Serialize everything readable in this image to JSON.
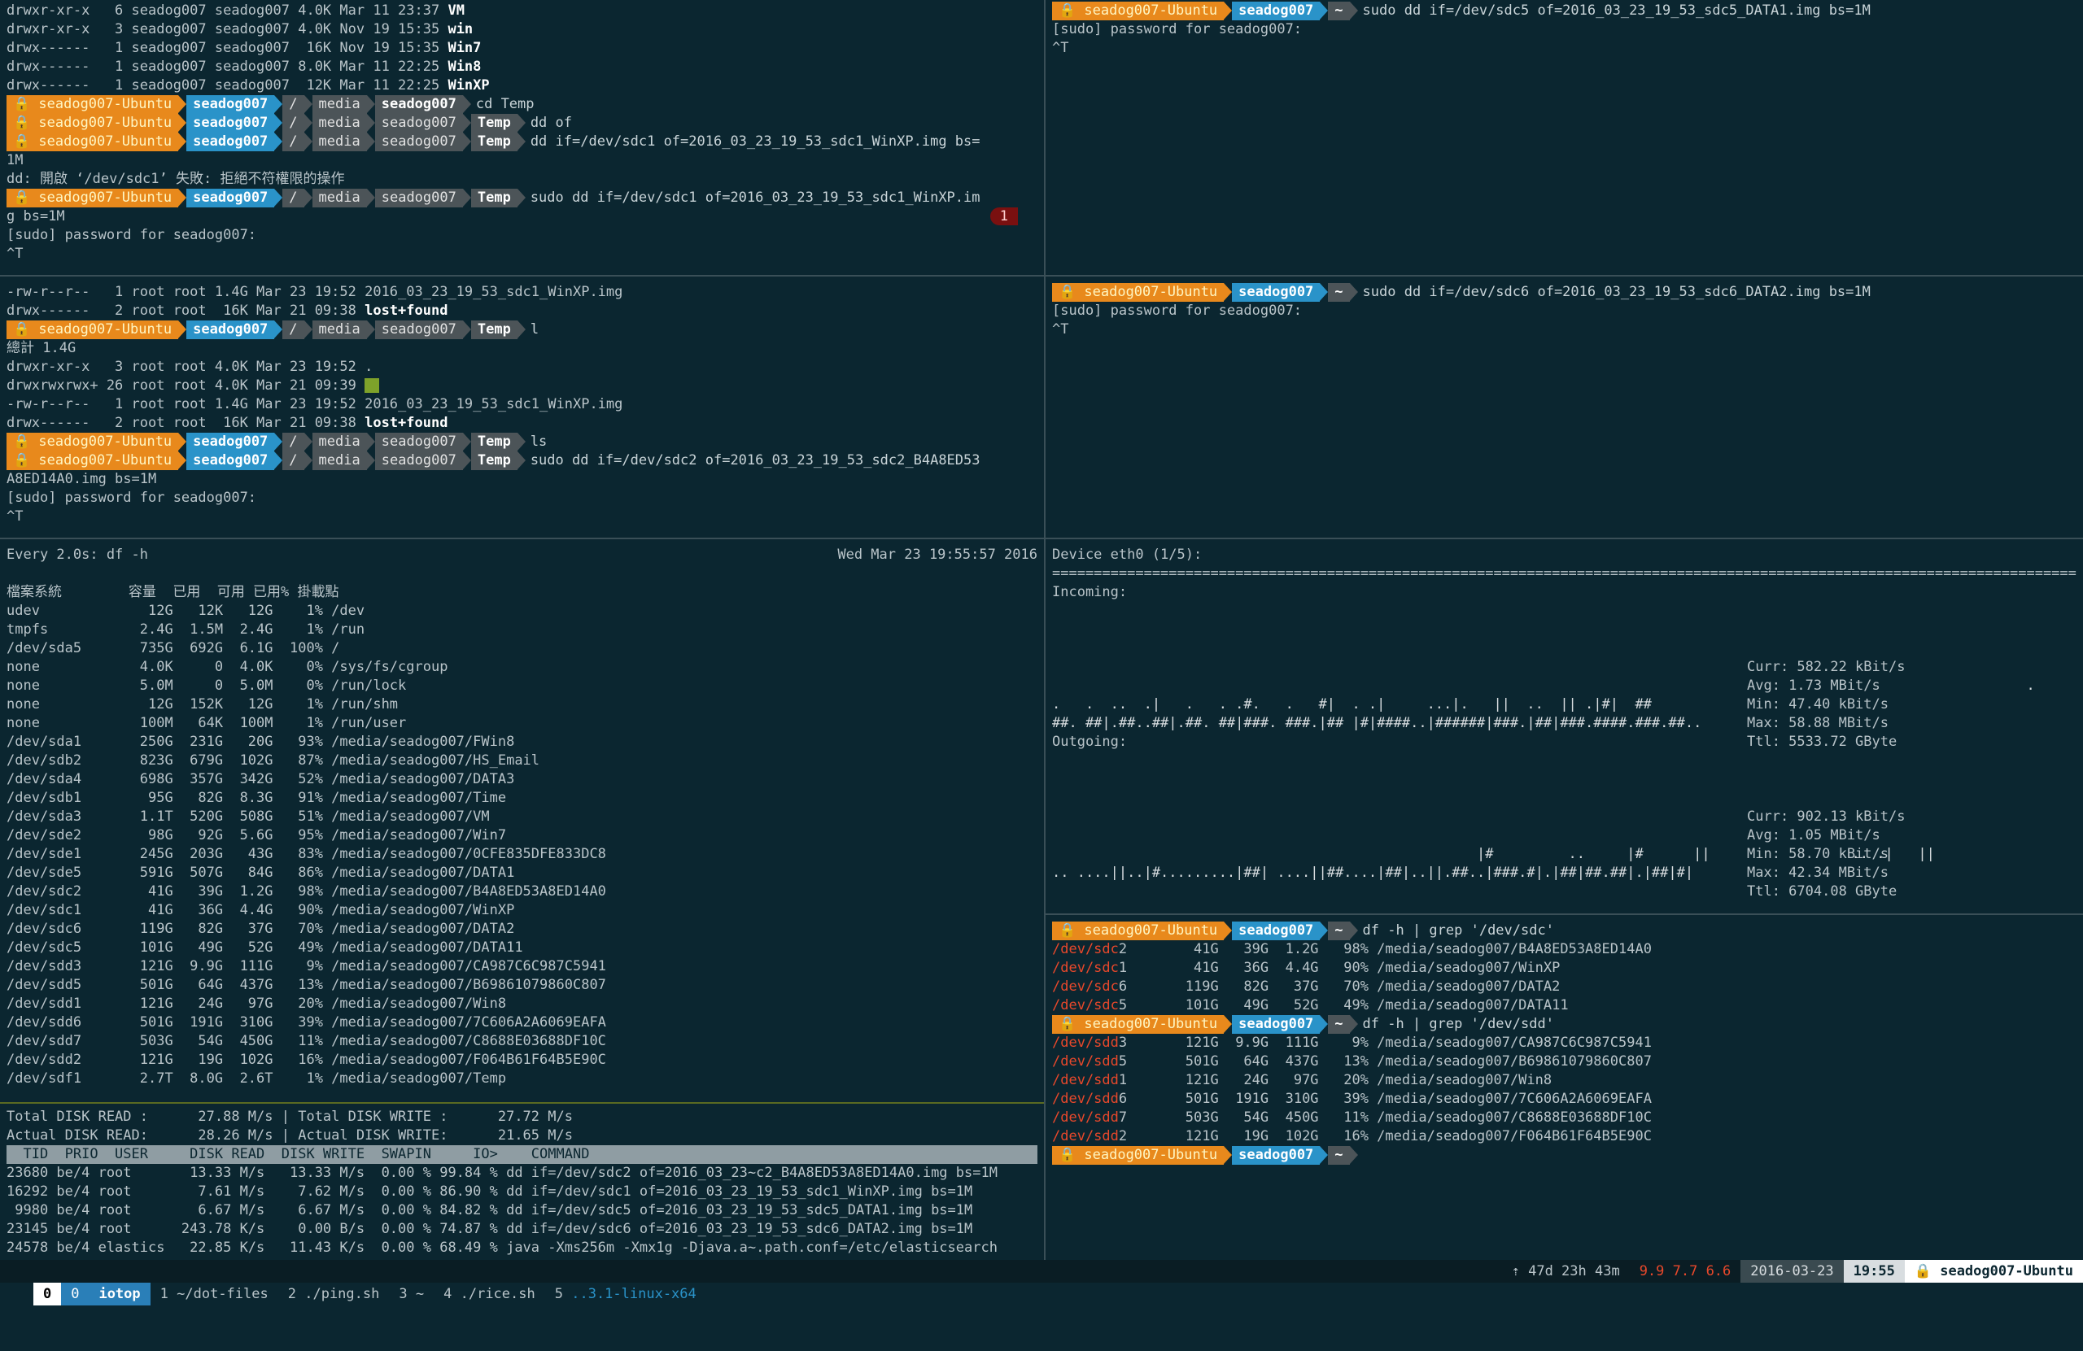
{
  "prompt": {
    "host": "🔒 seadog007-Ubuntu",
    "user": "seadog007",
    "root": "/",
    "media": "media",
    "temp": "Temp",
    "home": "~"
  },
  "pane1": {
    "ls_lines": [
      "drwxr-xr-x   6 seadog007 seadog007 4.0K Mar 11 23:37 ",
      "drwxr-xr-x   3 seadog007 seadog007 4.0K Nov 19 15:35 ",
      "drwx------   1 seadog007 seadog007  16K Nov 19 15:35 ",
      "drwx------   1 seadog007 seadog007 8.0K Mar 11 22:25 ",
      "drwx------   1 seadog007 seadog007  12K Mar 11 22:25 "
    ],
    "ls_names": [
      "VM",
      "win",
      "Win7",
      "Win8",
      "WinXP"
    ],
    "cmd_cd": "cd Temp",
    "cmd_ddof": "dd of",
    "cmd_dd": "dd if=/dev/sdc1 of=2016_03_23_19_53_sdc1_WinXP.img bs=",
    "dd_wrap": "1M",
    "dd_error": "dd: 開啟 ‘/dev/sdc1’ 失敗: 拒絕不符權限的操作",
    "cmd_sudo": "sudo dd if=/dev/sdc1 of=2016_03_23_19_53_sdc1_WinXP.im",
    "sudo_wrap": "g bs=1M",
    "badge": "1",
    "password": "[sudo] password for seadog007:",
    "ctrl": "^T"
  },
  "pane2": {
    "cmd": "sudo dd if=/dev/sdc5 of=2016_03_23_19_53_sdc5_DATA1.img bs=1M",
    "password": "[sudo] password for seadog007:",
    "ctrl": "^T"
  },
  "pane3": {
    "lines_top": [
      "-rw-r--r--   1 root root 1.4G Mar 23 19:52 2016_03_23_19_53_sdc1_WinXP.img",
      "drwx------   2 root root  16K Mar 21 09:38 "
    ],
    "lostfound": "lost+found",
    "cmd_l": "l",
    "total": "總計 1.4G",
    "dot_line": "drwxr-xr-x   3 root root 4.0K Mar 23 19:52 .",
    "dotdot_line": "drwxrwxrwx+ 26 root root 4.0K Mar 21 09:39 ",
    "img_line": "-rw-r--r--   1 root root 1.4G Mar 23 19:52 2016_03_23_19_53_sdc1_WinXP.img",
    "lost_line": "drwx------   2 root root  16K Mar 21 09:38 ",
    "cmd_ls": "ls",
    "cmd_sudo": "sudo dd if=/dev/sdc2 of=2016_03_23_19_53_sdc2_B4A8ED53",
    "sudo_wrap": "A8ED14A0.img bs=1M",
    "password": "[sudo] password for seadog007:",
    "ctrl": "^T"
  },
  "pane4": {
    "cmd": "sudo dd if=/dev/sdc6 of=2016_03_23_19_53_sdc6_DATA2.img bs=1M",
    "password": "[sudo] password for seadog007:",
    "ctrl": "^T"
  },
  "watch": {
    "header": "Every 2.0s: df -h",
    "time": "Wed Mar 23 19:55:57 2016",
    "table_header": "檔案系統        容量  已用  可用 已用% 掛載點",
    "rows": [
      "udev             12G   12K   12G    1% /dev",
      "tmpfs           2.4G  1.5M  2.4G    1% /run",
      "/dev/sda5       735G  692G  6.1G  100% /",
      "none            4.0K     0  4.0K    0% /sys/fs/cgroup",
      "none            5.0M     0  5.0M    0% /run/lock",
      "none             12G  152K   12G    1% /run/shm",
      "none            100M   64K  100M    1% /run/user",
      "/dev/sda1       250G  231G   20G   93% /media/seadog007/FWin8",
      "/dev/sdb2       823G  679G  102G   87% /media/seadog007/HS_Email",
      "/dev/sda4       698G  357G  342G   52% /media/seadog007/DATA3",
      "/dev/sdb1        95G   82G  8.3G   91% /media/seadog007/Time",
      "/dev/sda3       1.1T  520G  508G   51% /media/seadog007/VM",
      "/dev/sde2        98G   92G  5.6G   95% /media/seadog007/Win7",
      "/dev/sde1       245G  203G   43G   83% /media/seadog007/0CFE835DFE833DC8",
      "/dev/sde5       591G  507G   84G   86% /media/seadog007/DATA1",
      "/dev/sdc2        41G   39G  1.2G   98% /media/seadog007/B4A8ED53A8ED14A0",
      "/dev/sdc1        41G   36G  4.4G   90% /media/seadog007/WinXP",
      "/dev/sdc6       119G   82G   37G   70% /media/seadog007/DATA2",
      "/dev/sdc5       101G   49G   52G   49% /media/seadog007/DATA11",
      "/dev/sdd3       121G  9.9G  111G    9% /media/seadog007/CA987C6C987C5941",
      "/dev/sdd5       501G   64G  437G   13% /media/seadog007/B69861079860C807",
      "/dev/sdd1       121G   24G   97G   20% /media/seadog007/Win8",
      "/dev/sdd6       501G  191G  310G   39% /media/seadog007/7C606A2A6069EAFA",
      "/dev/sdd7       503G   54G  450G   11% /media/seadog007/C8688E03688DF10C",
      "/dev/sdd2       121G   19G  102G   16% /media/seadog007/F064B61F64B5E90C",
      "/dev/sdf1       2.7T  8.0G  2.6T    1% /media/seadog007/Temp"
    ]
  },
  "iotop": {
    "total": "Total DISK READ :      27.88 M/s | Total DISK WRITE :      27.72 M/s",
    "actual": "Actual DISK READ:      28.26 M/s | Actual DISK WRITE:      21.65 M/s",
    "header": "  TID  PRIO  USER     DISK READ  DISK WRITE  SWAPIN     IO>    COMMAND",
    "rows": [
      "23680 be/4 root       13.33 M/s   13.33 M/s  0.00 % 99.84 % dd if=/dev/sdc2 of=2016_03_23~c2_B4A8ED53A8ED14A0.img bs=1M",
      "16292 be/4 root        7.61 M/s    7.62 M/s  0.00 % 86.90 % dd if=/dev/sdc1 of=2016_03_23_19_53_sdc1_WinXP.img bs=1M",
      " 9980 be/4 root        6.67 M/s    6.67 M/s  0.00 % 84.82 % dd if=/dev/sdc5 of=2016_03_23_19_53_sdc5_DATA1.img bs=1M",
      "23145 be/4 root      243.78 K/s    0.00 B/s  0.00 % 74.87 % dd if=/dev/sdc6 of=2016_03_23_19_53_sdc6_DATA2.img bs=1M",
      "24578 be/4 elastics   22.85 K/s   11.43 K/s  0.00 % 68.49 % java -Xms256m -Xmx1g -Djava.a~.path.conf=/etc/elasticsearch"
    ]
  },
  "nload": {
    "device": "Device eth0 (1/5):",
    "rule": "=================================================================================================================================================================================",
    "incoming": "Incoming:",
    "in_graph": [
      "                                                                                                                                            ",
      "                                                                                                                                            ",
      "                                                                                                                                            ",
      "                                                                                                                                        .   ",
      "                                                                                                                     .                 .  ## ",
      ".   .  ..  .|   .   . .#.   .   #|  . .|     ...|.   ||  ..  || .|#|  ##      ",
      "##. ##|.##..##|.##. ##|###. ###.|## |#|####..|######|###.|##|###.####.###.##.. "
    ],
    "in_stats": [
      "Curr: 582.22 kBit/s",
      "Avg: 1.73 MBit/s",
      "Min: 47.40 kBit/s",
      "Max: 58.88 MBit/s",
      "Ttl: 5533.72 GByte"
    ],
    "outgoing": "Outgoing:",
    "out_graph": [
      "                                                                                                                                            ",
      "                                                                                                                                            ",
      "                                                                                                                                            ",
      "                                                                                                                                            ",
      "                                                                                                                                            ",
      "                                                   |#         ..     |#      ||                 .. .|   ||  ",
      ".. ....||..|#.........|##| ....||##....|##|..||.##..|###.#|.|##|##.##|.|##|#| "
    ],
    "out_stats": [
      "Curr: 902.13 kBit/s",
      "Avg: 1.05 MBit/s",
      "Min: 58.70 kBit/s",
      "Max: 42.34 MBit/s",
      "Ttl: 6704.08 GByte"
    ]
  },
  "grep": {
    "cmd1": "df -h | grep '/dev/sdc'",
    "sdc": [
      [
        "/dev/sdc",
        "2",
        "        41G   39G  1.2G   98% /media/seadog007/B4A8ED53A8ED14A0"
      ],
      [
        "/dev/sdc",
        "1",
        "        41G   36G  4.4G   90% /media/seadog007/WinXP"
      ],
      [
        "/dev/sdc",
        "6",
        "       119G   82G   37G   70% /media/seadog007/DATA2"
      ],
      [
        "/dev/sdc",
        "5",
        "       101G   49G   52G   49% /media/seadog007/DATA11"
      ]
    ],
    "cmd2": "df -h | grep '/dev/sdd'",
    "sdd": [
      [
        "/dev/sdd",
        "3",
        "       121G  9.9G  111G    9% /media/seadog007/CA987C6C987C5941"
      ],
      [
        "/dev/sdd",
        "5",
        "       501G   64G  437G   13% /media/seadog007/B69861079860C807"
      ],
      [
        "/dev/sdd",
        "1",
        "       121G   24G   97G   20% /media/seadog007/Win8"
      ],
      [
        "/dev/sdd",
        "6",
        "       501G  191G  310G   39% /media/seadog007/7C606A2A6069EAFA"
      ],
      [
        "/dev/sdd",
        "7",
        "       503G   54G  450G   11% /media/seadog007/C8688E03688DF10C"
      ],
      [
        "/dev/sdd",
        "2",
        "       121G   19G  102G   16% /media/seadog007/F064B61F64B5E90C"
      ]
    ]
  },
  "statusbar": {
    "session": "0",
    "cur_index": "0",
    "cur_name": "iotop",
    "windows": [
      {
        "index": "1",
        "name": "~/dot-files"
      },
      {
        "index": "2",
        "name": "./ping.sh"
      },
      {
        "index": "3",
        "name": "~"
      },
      {
        "index": "4",
        "name": "./rice.sh"
      },
      {
        "index": "5",
        "name": "..3.1-linux-x64"
      }
    ],
    "uptime": "⇡ 47d 23h 43m",
    "load": "9.9 7.7 6.6",
    "date": "2016-03-23",
    "time": "19:55",
    "host": "🔒 seadog007-Ubuntu"
  },
  "colors": {
    "background": "#0b2630",
    "host": "#e8891c",
    "user": "#2a93c9",
    "path": "#4c5458",
    "error": "#e8482b"
  }
}
